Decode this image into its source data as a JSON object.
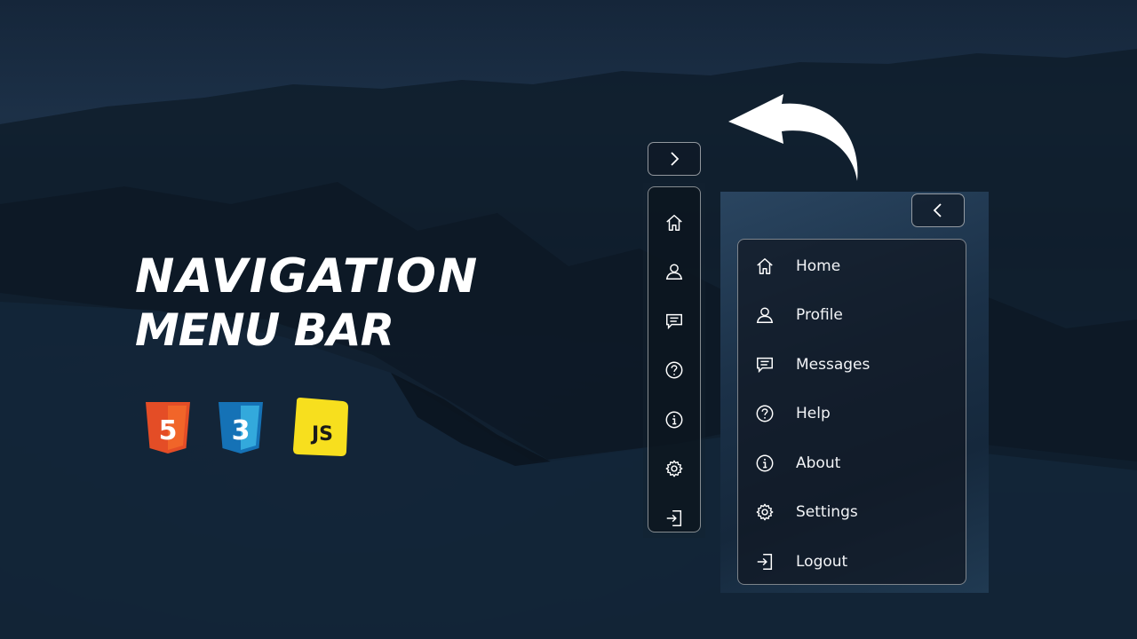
{
  "headline": {
    "line1": "NAVIGATION",
    "line2": "MENU BAR"
  },
  "tech_logos": [
    {
      "name": "html5-logo",
      "label": "5",
      "color": "#e44d26"
    },
    {
      "name": "css3-logo",
      "label": "3",
      "color": "#2965f1"
    },
    {
      "name": "javascript-logo",
      "label": "JS",
      "color": "#f7df1e"
    }
  ],
  "collapsed_menu": {
    "toggle_icon": "chevron-right-icon",
    "items": [
      {
        "icon": "home-icon"
      },
      {
        "icon": "user-icon"
      },
      {
        "icon": "message-icon"
      },
      {
        "icon": "help-icon"
      },
      {
        "icon": "info-icon"
      },
      {
        "icon": "settings-icon"
      },
      {
        "icon": "logout-icon"
      }
    ]
  },
  "expanded_menu": {
    "toggle_icon": "chevron-left-icon",
    "items": [
      {
        "label": "Home",
        "icon": "home-icon"
      },
      {
        "label": "Profile",
        "icon": "user-icon"
      },
      {
        "label": "Messages",
        "icon": "message-icon"
      },
      {
        "label": "Help",
        "icon": "help-icon"
      },
      {
        "label": "About",
        "icon": "info-icon"
      },
      {
        "label": "Settings",
        "icon": "settings-icon"
      },
      {
        "label": "Logout",
        "icon": "logout-icon"
      }
    ]
  },
  "colors": {
    "background_dark": "#132537",
    "panel_border": "#ffffff",
    "text": "#ffffff"
  }
}
